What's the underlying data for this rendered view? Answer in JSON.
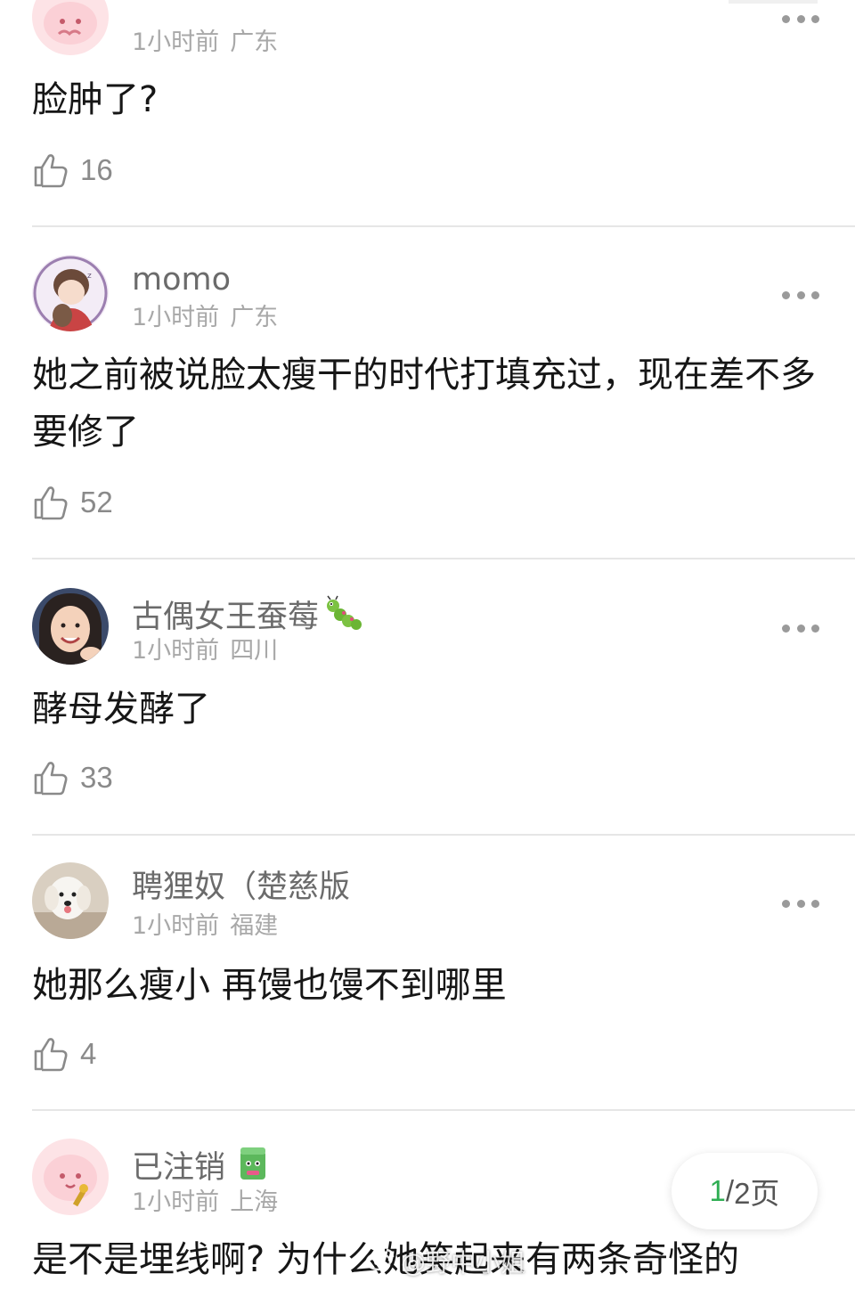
{
  "comments": [
    {
      "username": "",
      "time": "1小时前",
      "location": "广东",
      "text": "脸肿了?",
      "likes": "16"
    },
    {
      "username": "momo",
      "time": "1小时前",
      "location": "广东",
      "text": "她之前被说脸太瘦干的时代打填充过，现在差不多要修了",
      "likes": "52"
    },
    {
      "username": "古偶女王蚕莓",
      "badge_icon": "caterpillar-emoji",
      "time": "1小时前",
      "location": "四川",
      "text": "酵母发酵了",
      "likes": "33"
    },
    {
      "username": "聘狸奴（楚慈版",
      "time": "1小时前",
      "location": "福建",
      "text": "她那么瘦小 再馒也馒不到哪里",
      "likes": "4"
    },
    {
      "username": "已注销",
      "badge_icon": "green-cup-badge",
      "time": "1小时前",
      "location": "上海",
      "text": "是不是埋线啊? 为什么她笑起来有两条奇怪的",
      "likes": ""
    }
  ],
  "pager": {
    "current": "1",
    "separator": "/",
    "total_label": "2页"
  },
  "watermark": {
    "icon": "weibo-icon",
    "text": "@野中小姐"
  },
  "icons": {
    "like": "thumbs-up-icon",
    "more": "more-dots-icon"
  },
  "colors": {
    "username": "#6b6b6b",
    "meta": "#a8a8a8",
    "divider": "#e6e6e6",
    "pager_current": "#2fae53"
  }
}
